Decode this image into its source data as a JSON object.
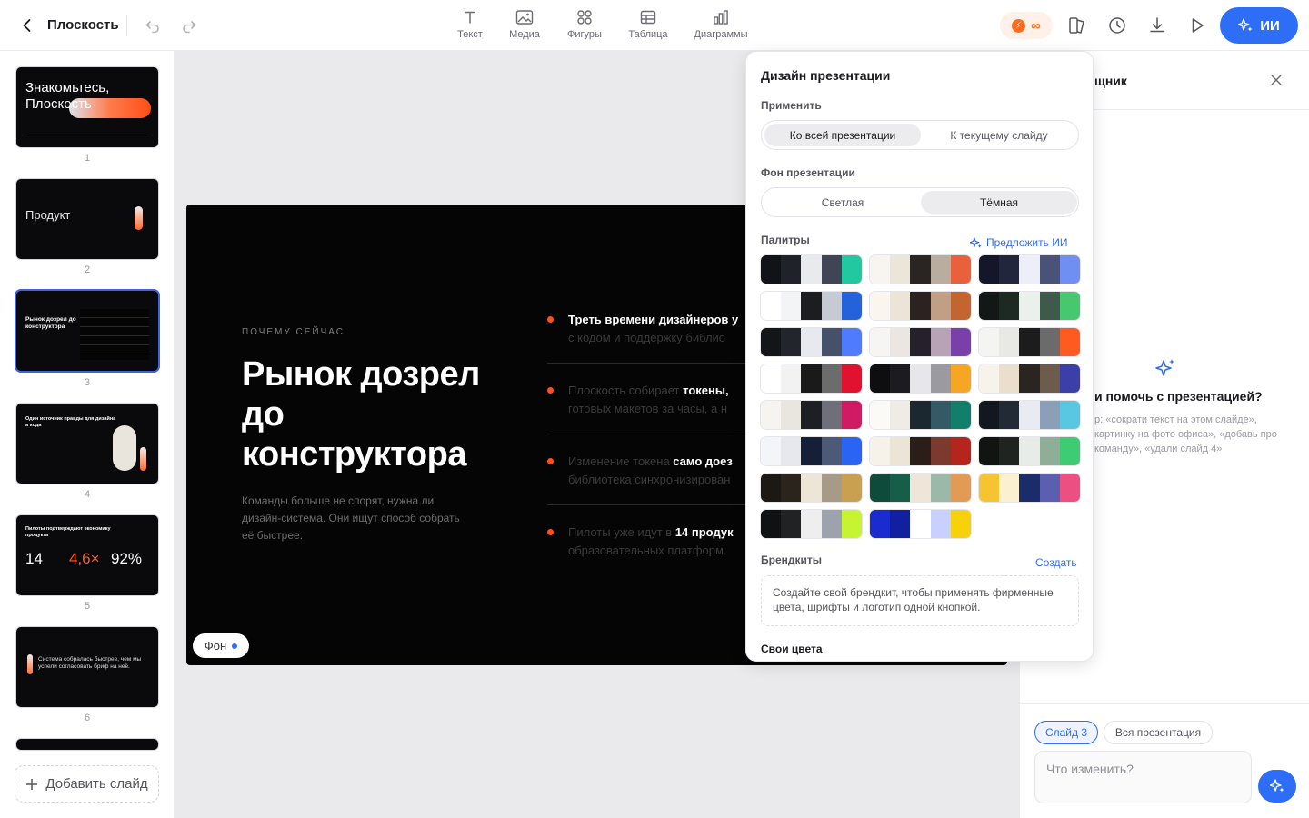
{
  "topbar": {
    "title": "Плоскость",
    "tools": [
      {
        "label": "Текст",
        "icon": "text-icon"
      },
      {
        "label": "Медиа",
        "icon": "media-icon"
      },
      {
        "label": "Фигуры",
        "icon": "shapes-icon"
      },
      {
        "label": "Таблица",
        "icon": "table-icon"
      },
      {
        "label": "Диаграммы",
        "icon": "charts-icon"
      }
    ],
    "credits_symbol": "∞",
    "ai_label": "ИИ"
  },
  "slides_panel": {
    "numbers": [
      "1",
      "2",
      "3",
      "4",
      "5",
      "6"
    ],
    "selected": 3,
    "thumb1_title": "Знакомьтесь, Плоскость",
    "thumb2_title": "Продукт",
    "thumb3_title": "Рынок дозрел до конструктора",
    "thumb4_title": "Один источник правды для дизайна и кода",
    "thumb5_title": "Пилоты подтверждают экономику продукта",
    "thumb5_stats": [
      "14",
      "4,6×",
      "92%"
    ],
    "thumb6_title": "Система собралась быстрее, чем мы успели согласовать бриф на неё.",
    "add_slide": "Добавить слайд"
  },
  "slide": {
    "eyebrow": "ПОЧЕМУ СЕЙЧАС",
    "title": "Рынок дозрел до конструктора",
    "lead": "Команды больше не спорят, нужна ли дизайн-система. Они ищут способ собрать её быстрее.",
    "bullets": [
      {
        "pre": "",
        "bold": "Треть времени дизайнеров у",
        "post": "",
        "line2": "с кодом и поддержку библио"
      },
      {
        "pre": "Плоскость собирает ",
        "bold": "токены,",
        "post": "",
        "line2": "готовых макетов за часы, а н"
      },
      {
        "pre": "Изменение токена ",
        "bold": "само доез",
        "post": "",
        "line2": "библиотека синхронизирован"
      },
      {
        "pre": "Пилоты уже идут в ",
        "bold": "14 продук",
        "post": "",
        "line2": "образовательных платформ."
      }
    ],
    "bg_button": "Фон"
  },
  "assistant": {
    "title_partial": "щник",
    "question_partial": "и помочь с презентацией?",
    "hint": "р: «сократи текст на этом слайде», картинку на фото офиса», «добавь  про команду», «удали слайд 4»",
    "chip_slide": "Слайд 3",
    "chip_all": "Вся презентация",
    "input_placeholder": "Что изменить?"
  },
  "design_panel": {
    "title": "Дизайн презентации",
    "apply_label": "Применить",
    "apply_options": [
      "Ко всей презентации",
      "К текущему слайду"
    ],
    "apply_selected": 0,
    "bg_label": "Фон презентации",
    "bg_options": [
      "Светлая",
      "Тёмная"
    ],
    "bg_selected": 1,
    "palettes_label": "Палитры",
    "suggest_label": "Предложить ИИ",
    "palettes": [
      [
        "#111318",
        "#1f2229",
        "#e9eaee",
        "#3f4555",
        "#22c9a0"
      ],
      [
        "#f8f4ef",
        "#ece5da",
        "#2a2522",
        "#b8ad9e",
        "#e8603c"
      ],
      [
        "#14172a",
        "#21263d",
        "#eceef8",
        "#4a5377",
        "#6f8ff2"
      ],
      [
        "#ffffff",
        "#f3f4f6",
        "#1c1d21",
        "#c5cad3",
        "#2462db"
      ],
      [
        "#faf5ef",
        "#ede4d8",
        "#2b231f",
        "#c19f86",
        "#c46431"
      ],
      [
        "#121815",
        "#1d2923",
        "#eaf1ec",
        "#3e5a4b",
        "#47c870"
      ],
      [
        "#141518",
        "#22252c",
        "#e7e9ee",
        "#455169",
        "#4f7cff"
      ],
      [
        "#f7f5f3",
        "#ebe6e2",
        "#24212a",
        "#b8a3b6",
        "#7a3fa8"
      ],
      [
        "#f4f4f2",
        "#e8e8e4",
        "#1c1c1c",
        "#6b6b6b",
        "#ff5a1f"
      ],
      [
        "#ffffff",
        "#f2f2f2",
        "#1a1a1a",
        "#6c6c6c",
        "#e0122d"
      ],
      [
        "#0e0e10",
        "#1c1c20",
        "#e7e7e9",
        "#9a9aa0",
        "#f5a623"
      ],
      [
        "#f8f3ea",
        "#eadfcb",
        "#2b2522",
        "#6d5c4c",
        "#3b3fa8"
      ],
      [
        "#f5f4f1",
        "#e8e6df",
        "#1e1f24",
        "#6e6f79",
        "#d01a64"
      ],
      [
        "#fbfaf7",
        "#efece6",
        "#1c2830",
        "#345a66",
        "#127f6c"
      ],
      [
        "#131820",
        "#222a36",
        "#e8ecf2",
        "#8ba0b8",
        "#5ac7e2"
      ],
      [
        "#f4f5f8",
        "#e6e8ee",
        "#152038",
        "#4c5a78",
        "#2a64f5"
      ],
      [
        "#f6f2ea",
        "#ebe4d7",
        "#2b1d18",
        "#7a3a2e",
        "#b4261d"
      ],
      [
        "#121412",
        "#1f2420",
        "#e8ece8",
        "#8fae97",
        "#3dcb74"
      ],
      [
        "#1c1915",
        "#2a241d",
        "#ede5d6",
        "#a59b88",
        "#c9a050"
      ],
      [
        "#0f4b3a",
        "#175e48",
        "#efe5d8",
        "#9ab9a8",
        "#e29b55"
      ],
      [
        "#f6c431",
        "#fbf1d0",
        "#1b2c6a",
        "#5a5fb0",
        "#ee4f83"
      ],
      [
        "#101112",
        "#202224",
        "#eeeeef",
        "#9da3ad",
        "#c6f432"
      ],
      [
        "#1a2bd0",
        "#1020a0",
        "#ffffff",
        "#c7d0ff",
        "#f7d10a"
      ]
    ],
    "brandkits_label": "Брендкиты",
    "create_label": "Создать",
    "brandkits_text": "Создайте свой брендкит, чтобы применять фирменные цвета, шрифты и логотип одной кнопкой.",
    "own_colors_label": "Свои цвета"
  }
}
